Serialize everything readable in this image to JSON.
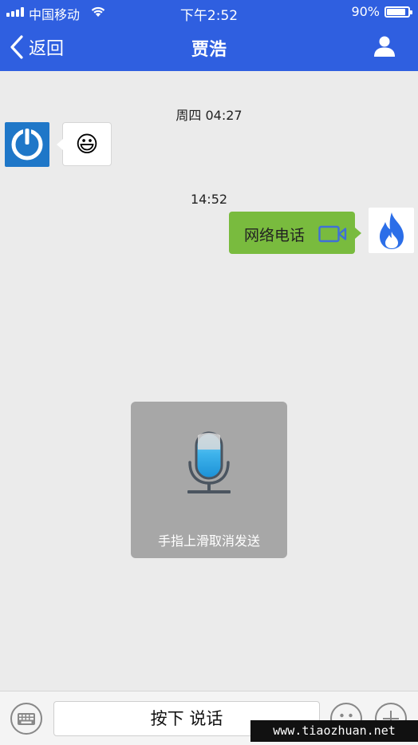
{
  "status_bar": {
    "carrier": "中国移动",
    "time": "下午2:52",
    "battery": "90%"
  },
  "nav": {
    "back_label": "返回",
    "title": "贾浩",
    "right_icon": "person-icon"
  },
  "messages": {
    "timestamp_1": "周四 04:27",
    "emoji": "😃",
    "timestamp_2": "14:52",
    "call_label": "网络电话"
  },
  "recording": {
    "hint": "手指上滑取消发送"
  },
  "toolbar": {
    "talk_label": "按下 说话"
  },
  "watermark": "www.tiaozhuan.net",
  "colors": {
    "nav_blue": "#2f5fe0",
    "bubble_green": "#79bb3e",
    "flame_blue": "#2b6ee8",
    "avatar_blue": "#1f77c8"
  }
}
